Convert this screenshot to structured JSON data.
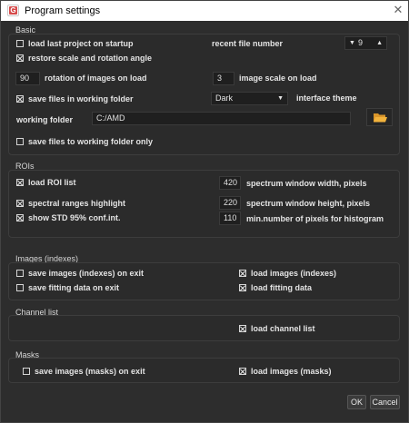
{
  "window": {
    "title": "Program settings",
    "app_icon_letter": "G"
  },
  "basic": {
    "group_label": "Basic",
    "load_last_project": {
      "label": "load last project on startup",
      "checked": false
    },
    "recent_file_number_label": "recent file number",
    "recent_file_number_value": "9",
    "restore_scale": {
      "label": "restore scale and rotation angle",
      "checked": true
    },
    "rotation_value": "90",
    "rotation_label": "rotation of images on load",
    "image_scale_value": "3",
    "image_scale_label": "image scale on load",
    "save_in_working_folder": {
      "label": "save files in working folder",
      "checked": true
    },
    "theme_value": "Dark",
    "theme_label": "interface theme",
    "working_folder_label": "working folder",
    "working_folder_value": "C:/AMD",
    "save_only_working": {
      "label": "save files to working folder only",
      "checked": false
    }
  },
  "rois": {
    "group_label": "ROIs",
    "load_roi_list": {
      "label": "load ROI list",
      "checked": true
    },
    "spectral_highlight": {
      "label": "spectral ranges highlight",
      "checked": true
    },
    "show_std": {
      "label": "show STD  95% conf.int.",
      "checked": true
    },
    "spectrum_width_value": "420",
    "spectrum_width_label": "spectrum window width, pixels",
    "spectrum_height_value": "220",
    "spectrum_height_label": "spectrum window height, pixels",
    "min_pixels_value": "110",
    "min_pixels_label": "min.number of pixels for histogram"
  },
  "images": {
    "group_label": "Images (indexes)",
    "save_images_exit": {
      "label": "save images (indexes) on exit",
      "checked": false
    },
    "save_fitting_exit": {
      "label": "save fitting data on exit",
      "checked": false
    },
    "load_images": {
      "label": "load images (indexes)",
      "checked": true
    },
    "load_fitting": {
      "label": "load fitting data",
      "checked": true
    }
  },
  "channel_list": {
    "group_label": "Channel list",
    "load_channel_list": {
      "label": "load channel list",
      "checked": true
    }
  },
  "masks": {
    "group_label": "Masks",
    "save_masks_exit": {
      "label": "save images (masks) on exit",
      "checked": false
    },
    "load_masks": {
      "label": "load images (masks)",
      "checked": true
    }
  },
  "buttons": {
    "ok": "OK",
    "cancel": "Cancel"
  },
  "colors": {
    "background": "#2d2d2d",
    "titlebar": "#ffffff",
    "field_bg": "#1f1f1f",
    "folder_icon": "#f2b33d"
  }
}
